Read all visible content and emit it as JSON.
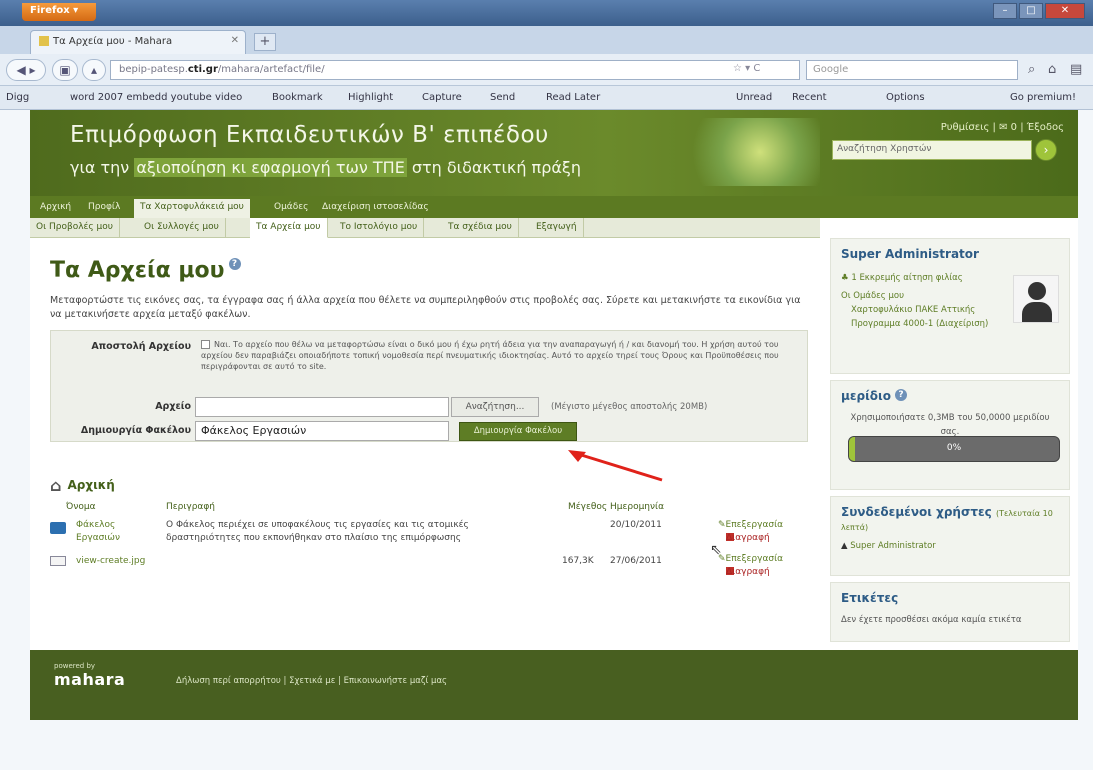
{
  "browser": {
    "menu_button": "Firefox",
    "tab_title": "Τα Αρχεία μου - Mahara",
    "url_prefix": "bepip-patesp.",
    "url_domain": "cti.gr",
    "url_suffix": "/mahara/artefact/file/",
    "search_placeholder": "Google",
    "bookmarks": [
      "Digg",
      "word 2007 embedd youtube video",
      "Bookmark",
      "Highlight",
      "Capture",
      "Send",
      "Read Later",
      "Unread",
      "Recent",
      "Options",
      "Go premium!"
    ]
  },
  "site": {
    "title_line1": "Επιμόρφωση Εκπαιδευτικών  Β' επιπέδου",
    "title_line2_pre": "για την ",
    "title_line2_hl1": "αξιοποίηση κι εφαρμογή των ΤΠΕ",
    "title_line2_post": " στη διδακτική πράξη",
    "userlinks": "Ρυθμίσεις | ✉ 0 | Έξοδος",
    "search_placeholder": "Αναζήτηση Χρηστών"
  },
  "nav": {
    "main": [
      "Αρχική",
      "Προφίλ",
      "Τα Χαρτοφυλάκειά μου",
      "Ομάδες",
      "Διαχείριση ιστοσελίδας"
    ],
    "sub": [
      "Οι Προβολές μου",
      "Οι Συλλογές μου",
      "Τα Αρχεία μου",
      "Το Ιστολόγιο μου",
      "Τα σχέδια μου",
      "Εξαγωγή"
    ]
  },
  "main": {
    "title": "Τα Αρχεία μου",
    "intro": "Μεταφορτώστε τις εικόνες σας, τα έγγραφα σας ή άλλα αρχεία που θέλετε να συμπεριληφθούν στις προβολές σας. Σύρετε και μετακινήστε τα εικονίδια για να μετακινήσετε αρχεία μεταξύ φακέλων.",
    "upload_label": "Αποστολή Αρχείου",
    "upload_notice": "Ναι. Το αρχείο που θέλω να μεταφορτώσω είναι ο δικό μου ή έχω ρητή άδεια για την αναπαραγωγή ή / και διανομή του. Η χρήση αυτού του αρχείου δεν παραβιάζει οποιαδήποτε τοπική νομοθεσία περί πνευματικής ιδιοκτησίας. Αυτό το αρχείο τηρεί τους Όρους και Προϋποθέσεις που περιγράφονται σε αυτό το site.",
    "file_label": "Αρχείο",
    "browse_label": "Αναζήτηση...",
    "max_size": "(Μέγιστο μέγεθος αποστολής 20MB)",
    "folder_label": "Δημιουργία Φακέλου",
    "folder_value": "Φάκελος Εργασιών",
    "create_button": "Δημιουργία Φακέλου",
    "breadcrumb": "Αρχική",
    "columns": {
      "name": "Όνομα",
      "description": "Περιγραφή",
      "size": "Μέγεθος",
      "date": "Ημερομηνία"
    },
    "rows": [
      {
        "name1": "Φάκελος",
        "name2": "Εργασιών",
        "desc1": "Ο Φάκελος περιέχει σε υποφακέλους τις εργασίες και τις ατομικές",
        "desc2": "δραστηριότητες που εκπονήθηκαν στο πλαίσιο της επιμόρφωσης",
        "size": "",
        "date": "20/10/2011",
        "edit": "Επεξεργασία",
        "delete": "Διαγραφή"
      },
      {
        "name1": "view-create.jpg",
        "name2": "",
        "desc1": "",
        "desc2": "",
        "size": "167,3K",
        "date": "27/06/2011",
        "edit": "Επεξεργασία",
        "delete": "Διαγραφή"
      }
    ]
  },
  "sidebar": {
    "user_name": "Super Administrator",
    "pending": "1 Εκκρεμής αίτηση φιλίας",
    "groups_label": "Οι Ομάδες μου",
    "group_item": "Χαρτοφυλάκιο ΠΑΚΕ Αττικής Προγραμμα 4000-1 (Διαχείριση)",
    "quota_title": "μερίδιο",
    "quota_text": "Χρησιμοποιήσατε 0,3MB του 50,0000 μεριδίου σας.",
    "quota_percent": "0%",
    "quota_fraction": 0.01,
    "online_title": "Συνδεδεμένοι χρήστες",
    "online_note": "(Τελευταία 10 λεπτά)",
    "online_user": "Super Administrator",
    "tags_title": "Ετικέτες",
    "tags_text": "Δεν έχετε προσθέσει ακόμα καμία ετικέτα"
  },
  "footer": {
    "powered": "powered by",
    "logo": "mahara",
    "links": "Δήλωση περί απορρήτου  |  Σχετικά με  |  Επικοινωνήστε μαζί μας"
  }
}
